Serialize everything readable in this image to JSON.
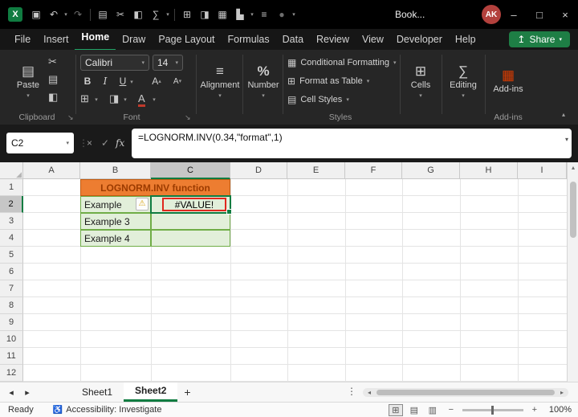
{
  "titlebar": {
    "document_title": "Book...",
    "avatar": "AK"
  },
  "menu": {
    "items": [
      "File",
      "Insert",
      "Home",
      "Draw",
      "Page Layout",
      "Formulas",
      "Data",
      "Review",
      "View",
      "Developer",
      "Help"
    ],
    "share": "Share"
  },
  "ribbon": {
    "paste": "Paste",
    "clipboard_label": "Clipboard",
    "font_name": "Calibri",
    "font_size": "14",
    "bold": "B",
    "italic": "I",
    "underline": "U",
    "grow_font": "A",
    "shrink_font": "A",
    "font_color_letter": "A",
    "font_label": "Font",
    "alignment_label": "Alignment",
    "number_icon": "%",
    "number_label": "Number",
    "conditional_formatting": "Conditional Formatting",
    "format_as_table": "Format as Table",
    "cell_styles": "Cell Styles",
    "styles_label": "Styles",
    "cells_label": "Cells",
    "editing_label": "Editing",
    "addins_label": "Add-ins"
  },
  "formula_bar": {
    "name_box": "C2",
    "fx": "fx",
    "formula": "=LOGNORM.INV(0.34,\"format\",1)"
  },
  "grid": {
    "columns": [
      "A",
      "B",
      "C",
      "D",
      "E",
      "F",
      "G",
      "H",
      "I"
    ],
    "rows": [
      "1",
      "2",
      "3",
      "4",
      "5",
      "6",
      "7",
      "8",
      "9",
      "10",
      "11",
      "12"
    ],
    "merged_header": "LOGNORM.INV function",
    "b2": "Example",
    "c2": "#VALUE!",
    "b3": "Example 3",
    "b4": "Example 4"
  },
  "sheets": {
    "sheet1": "Sheet1",
    "sheet2": "Sheet2",
    "add": "+"
  },
  "status": {
    "mode": "Ready",
    "accessibility": "Accessibility: Investigate",
    "zoom": "100%"
  },
  "colors": {
    "accent_green": "#107C41",
    "header_fill": "#ED7D31",
    "example_fill": "#E2EFDA",
    "table_border": "#70AD47",
    "error_border": "#E0281E"
  },
  "icons": {
    "excel_logo": "X",
    "save": "▣",
    "undo": "↶",
    "redo": "↷",
    "copy": "▤",
    "cut": "✂",
    "format_painter": "◧",
    "sum": "∑",
    "sort": "≡",
    "table": "⊞",
    "fill": "◨",
    "borders": "▦",
    "chart": "▙",
    "list": "≡",
    "record": "●",
    "chevron_down": "▾",
    "chevron_up": "▴",
    "minimize": "–",
    "maximize": "□",
    "close": "×",
    "cancel": "×",
    "check": "✓",
    "dialog_launcher": "↘",
    "corner_triangle": "◢",
    "warning": "⚠",
    "arrow_left": "◂",
    "arrow_right": "▸",
    "arrow_up": "▴",
    "dots_vertical": "⋮",
    "accessibility": "♿",
    "view_normal": "⊞",
    "view_layout": "▤",
    "view_break": "▥",
    "zoom_minus": "−",
    "zoom_plus": "+",
    "share_arrow": "↥"
  }
}
